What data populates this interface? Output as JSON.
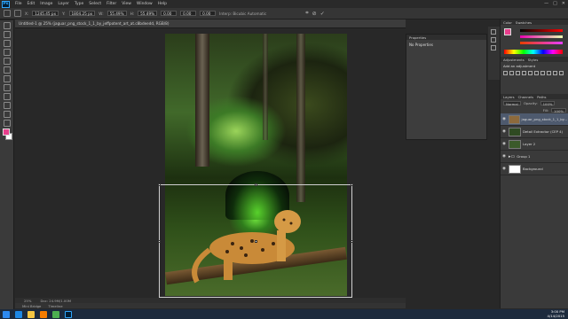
{
  "app": {
    "logo": "Ps"
  },
  "menu": [
    "File",
    "Edit",
    "Image",
    "Layer",
    "Type",
    "Select",
    "Filter",
    "View",
    "Window",
    "Help"
  ],
  "window_controls": [
    "—",
    "□",
    "✕"
  ],
  "options": {
    "x_label": "X:",
    "x_value": "1245.45 px",
    "y_label": "Y:",
    "y_value": "1804.25 px",
    "w_label": "W:",
    "w_value": "55.49%",
    "h_label": "H:",
    "h_value": "55.49%",
    "angle_value": "0.00",
    "h2_value": "0.00",
    "v_value": "0.00",
    "interp_label": "Interp: Bicubic Automatic"
  },
  "document": {
    "tab_title": "Untitled-1 @ 25% (jaguar_png_stock_1_1_by_jeffpotent_art_at.c8bdeedd, RGB/8)"
  },
  "status": {
    "zoom": "25%",
    "doc_size": "Doc: 24.9M/1.00M"
  },
  "mini_bridge": [
    "Mini Bridge",
    "Timeline"
  ],
  "properties": {
    "tab": "Properties",
    "body": "No Properties"
  },
  "color_panel": {
    "tabs": [
      "Color",
      "Swatches"
    ]
  },
  "adjustments": {
    "tabs": [
      "Adjustments",
      "Styles"
    ],
    "title": "Add an adjustment"
  },
  "layers_panel": {
    "tabs": [
      "Layers",
      "Channels",
      "Paths"
    ],
    "kind": "Normal",
    "opacity_label": "Opacity:",
    "opacity_value": "100%",
    "fill_label": "Fill:",
    "fill_value": "100%",
    "layers": [
      {
        "name": "jaguar_png_stock_1_1_by...",
        "selected": true
      },
      {
        "name": "Detail Extractor (CEP 4)",
        "selected": false
      },
      {
        "name": "Layer 2",
        "selected": false
      },
      {
        "name": "Group 1",
        "selected": false
      },
      {
        "name": "Background",
        "selected": false
      }
    ]
  },
  "taskbar": {
    "time": "3:00 PM",
    "date": "4/14/2015"
  },
  "colors": {
    "foreground": "#e83e8c",
    "background": "#ffffff",
    "selected_layer": "#4e5a6e"
  }
}
